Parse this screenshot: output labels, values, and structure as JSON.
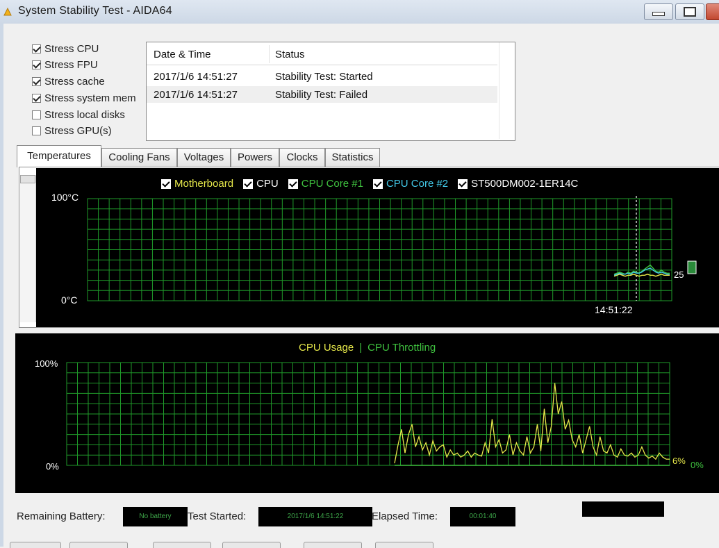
{
  "window": {
    "title": "System Stability Test - AIDA64"
  },
  "stress_options": [
    {
      "label": "Stress CPU",
      "checked": true
    },
    {
      "label": "Stress FPU",
      "checked": true
    },
    {
      "label": "Stress cache",
      "checked": true
    },
    {
      "label": "Stress system mem",
      "checked": true
    },
    {
      "label": "Stress local disks",
      "checked": false
    },
    {
      "label": "Stress GPU(s)",
      "checked": false
    }
  ],
  "log": {
    "columns": [
      "Date & Time",
      "Status"
    ],
    "rows": [
      {
        "datetime": "2017/1/6 14:51:27",
        "status": "Stability Test: Started"
      },
      {
        "datetime": "2017/1/6 14:51:27",
        "status": "Stability Test: Failed"
      }
    ]
  },
  "tabs": [
    {
      "label": "Temperatures",
      "active": true
    },
    {
      "label": "Cooling Fans",
      "active": false
    },
    {
      "label": "Voltages",
      "active": false
    },
    {
      "label": "Powers",
      "active": false
    },
    {
      "label": "Clocks",
      "active": false
    },
    {
      "label": "Statistics",
      "active": false
    }
  ],
  "temperature_chart": {
    "legend": [
      {
        "label": "Motherboard",
        "color": "#e6e84a"
      },
      {
        "label": "CPU",
        "color": "#ffffff"
      },
      {
        "label": "CPU Core #1",
        "color": "#3fc23f"
      },
      {
        "label": "CPU Core #2",
        "color": "#43c9e8"
      },
      {
        "label": "ST500DM002-1ER14C",
        "color": "#ffffff"
      }
    ],
    "y_max_label": "100°C",
    "y_min_label": "0°C",
    "current_value_label": "25",
    "time_label": "14:51:22",
    "grid_color": "#1f9a2a"
  },
  "usage_chart": {
    "title_cpu_usage": "CPU Usage",
    "title_separator": "|",
    "title_throttling": "CPU Throttling",
    "cpu_usage_color": "#e6e84a",
    "throttling_color": "#3fc23f",
    "y_max_label": "100%",
    "y_min_label": "0%",
    "current_usage_label": "6%",
    "current_throttling_label": "0%",
    "grid_color": "#1f9a2a"
  },
  "chart_data": [
    {
      "type": "line",
      "title": "",
      "ylabel": "",
      "ylim": [
        0,
        100
      ],
      "series": [
        {
          "name": "Motherboard",
          "x": [
            0,
            1,
            2,
            3,
            4,
            5,
            6,
            7,
            8,
            9,
            10,
            11,
            12,
            13,
            14,
            15,
            16,
            17,
            18,
            19,
            20
          ],
          "values": [
            24,
            25,
            26,
            25,
            24,
            25,
            25,
            26,
            25,
            24,
            25,
            25,
            26,
            25,
            25,
            24,
            25,
            26,
            25,
            25,
            25
          ]
        },
        {
          "name": "CPU Core #1",
          "x": [
            0,
            1,
            2,
            3,
            4,
            5,
            6,
            7,
            8,
            9,
            10,
            11,
            12,
            13,
            14,
            15,
            16,
            17,
            18,
            19,
            20
          ],
          "values": [
            26,
            27,
            28,
            27,
            26,
            28,
            27,
            29,
            28,
            27,
            29,
            31,
            33,
            35,
            32,
            29,
            28,
            30,
            28,
            27,
            27
          ]
        },
        {
          "name": "CPU Core #2",
          "x": [
            0,
            1,
            2,
            3,
            4,
            5,
            6,
            7,
            8,
            9,
            10,
            11,
            12,
            13,
            14,
            15,
            16,
            17,
            18,
            19,
            20
          ],
          "values": [
            25,
            26,
            27,
            26,
            26,
            27,
            26,
            28,
            27,
            27,
            28,
            30,
            31,
            32,
            30,
            28,
            27,
            28,
            27,
            26,
            26
          ]
        }
      ]
    },
    {
      "type": "line",
      "title": "CPU Usage | CPU Throttling",
      "ylim": [
        0,
        100
      ],
      "series": [
        {
          "name": "CPU Usage",
          "x": [
            0,
            1,
            2,
            3,
            4,
            5,
            6,
            7,
            8,
            9,
            10,
            11,
            12,
            13,
            14,
            15,
            16,
            17,
            18,
            19,
            20,
            21,
            22,
            23,
            24,
            25,
            26,
            27,
            28,
            29,
            30,
            31,
            32,
            33,
            34,
            35,
            36,
            37,
            38,
            39,
            40,
            41,
            42,
            43,
            44,
            45,
            46,
            47,
            48,
            49,
            50,
            51,
            52,
            53,
            54,
            55,
            56,
            57,
            58,
            59,
            60,
            61,
            62,
            63,
            64,
            65,
            66,
            67,
            68,
            69,
            70,
            71,
            72,
            73,
            74,
            75,
            76,
            77,
            78,
            79
          ],
          "values": [
            2,
            20,
            35,
            12,
            30,
            40,
            18,
            28,
            15,
            22,
            10,
            24,
            14,
            18,
            20,
            8,
            15,
            10,
            12,
            8,
            10,
            14,
            8,
            12,
            10,
            9,
            22,
            12,
            45,
            18,
            25,
            12,
            15,
            30,
            10,
            22,
            14,
            10,
            28,
            12,
            18,
            40,
            14,
            55,
            22,
            38,
            80,
            50,
            62,
            35,
            44,
            25,
            18,
            30,
            12,
            25,
            38,
            18,
            10,
            28,
            14,
            12,
            20,
            10,
            8,
            16,
            10,
            9,
            12,
            8,
            10,
            18,
            10,
            7,
            9,
            6,
            12,
            8,
            6,
            6
          ]
        },
        {
          "name": "CPU Throttling",
          "x": [
            0,
            79
          ],
          "values": [
            0,
            0
          ]
        }
      ]
    }
  ],
  "bottom": {
    "battery_label": "Remaining Battery:",
    "battery_value": "No battery",
    "started_label": "Test Started:",
    "started_value": "2017/1/6 14:51:22",
    "elapsed_label": "Elapsed Time:",
    "elapsed_value": "00:01:40"
  }
}
